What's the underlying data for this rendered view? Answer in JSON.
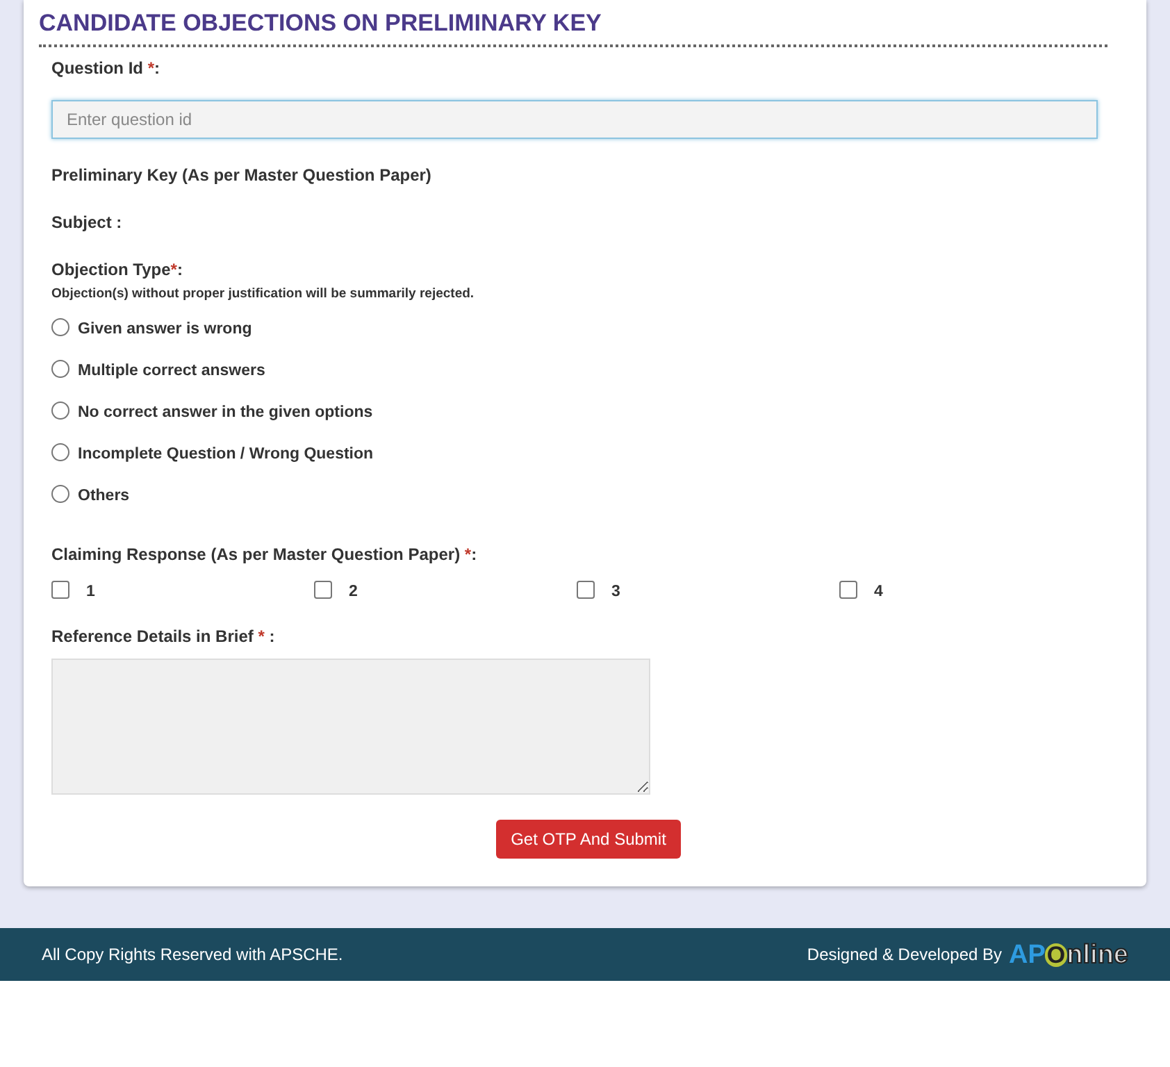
{
  "title": "CANDIDATE OBJECTIONS ON PRELIMINARY KEY",
  "question_id": {
    "label": "Question Id ",
    "mark": "*",
    "suffix": ":",
    "placeholder": "Enter question id"
  },
  "preliminary_key": "Preliminary Key (As per Master Question Paper)",
  "subject": "Subject :",
  "objection_type": {
    "label": "Objection Type",
    "mark": "*",
    "suffix": ":",
    "note": "Objection(s) without proper justification will be summarily rejected.",
    "options": [
      {
        "label": "Given answer is wrong",
        "selected": false
      },
      {
        "label": "Multiple correct answers",
        "selected": false
      },
      {
        "label": "No correct answer in the given options",
        "selected": false
      },
      {
        "label": "Incomplete Question / Wrong Question",
        "selected": false
      },
      {
        "label": "Others",
        "selected": false
      }
    ]
  },
  "claiming_response": {
    "label": "Claiming Response (As per Master Question Paper) ",
    "mark": "*",
    "suffix": ":",
    "options": [
      {
        "label": "1",
        "checked": false
      },
      {
        "label": "2",
        "checked": false
      },
      {
        "label": "3",
        "checked": false
      },
      {
        "label": "4",
        "checked": false
      }
    ]
  },
  "reference": {
    "label": "Reference Details in Brief ",
    "mark": "*",
    "suffix": " :"
  },
  "submit_button": "Get OTP And Submit",
  "footer": {
    "copyright": "All Copy Rights Reserved with APSCHE.",
    "credit": "Designed & Developed By",
    "logo": {
      "first": "AP",
      "second": "O",
      "rest": "nline"
    }
  }
}
